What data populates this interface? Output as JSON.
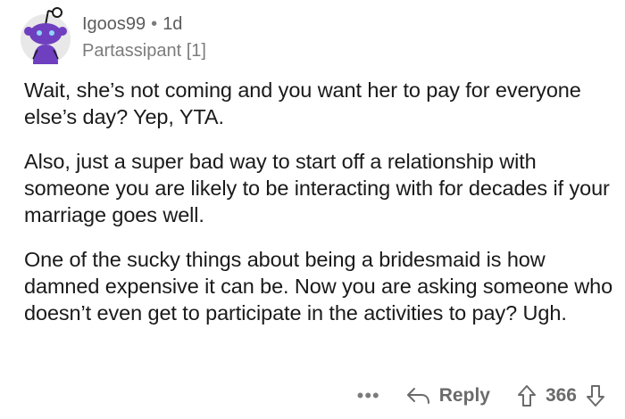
{
  "comment": {
    "username": "Igoos99",
    "separator": "•",
    "age": "1d",
    "flair": "Partassipant [1]",
    "paragraphs": [
      "Wait, she’s not coming and you want her to pay for everyone else’s day?  Yep, YTA.",
      "Also, just a super bad way to start off a relationship with someone you are likely to be interacting with for decades if your marriage goes well.",
      "One of the sucky things about being a bridesmaid is how damned expensive it can be. Now you are asking someone who doesn’t even get to participate in the activities to pay? Ugh."
    ],
    "actions": {
      "more": "•••",
      "reply_label": "Reply",
      "score": "366"
    }
  },
  "icons": {
    "avatar": "snoo-avatar-icon",
    "reply": "reply-arrow-icon",
    "upvote": "upvote-arrow-icon",
    "downvote": "downvote-arrow-icon"
  },
  "colors": {
    "avatar_bg": "#e8e8e8",
    "snoo_purple": "#6e3fbf",
    "text": "#1a1a1b",
    "muted": "#7c7c7c"
  }
}
